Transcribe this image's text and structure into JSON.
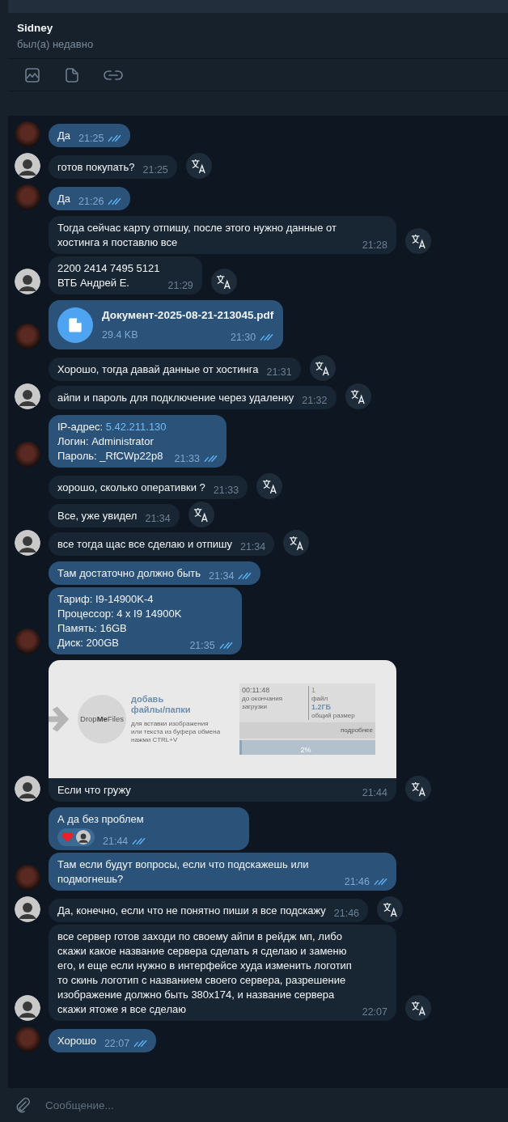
{
  "chat": {
    "name": "Sidney",
    "status": "был(а) недавно"
  },
  "toolbar": [
    {
      "kind": "media"
    },
    {
      "kind": "file"
    },
    {
      "kind": "link"
    }
  ],
  "messages": [
    {
      "kind": "text",
      "outgoing": true,
      "avatar": true,
      "text": "Да",
      "time": "21:25",
      "read": true
    },
    {
      "kind": "text",
      "outgoing": false,
      "avatar": true,
      "text": "готов покупать?",
      "time": "21:25"
    },
    {
      "kind": "text",
      "outgoing": true,
      "avatar": true,
      "text": "Да",
      "time": "21:26",
      "read": true
    },
    {
      "kind": "text",
      "outgoing": false,
      "avatar": false,
      "text": "Тогда сейчас карту отпишу, после этого нужно данные от хостинга я поставлю все",
      "time": "21:28"
    },
    {
      "kind": "text",
      "outgoing": false,
      "avatar": true,
      "text": "2200 2414 7495 5121\nВТБ Андрей Е.",
      "time": "21:29"
    },
    {
      "kind": "file",
      "outgoing": true,
      "avatar": true,
      "file_name": "Документ-2025-08-21-213045.pdf",
      "size": "29.4 KB",
      "time": "21:30",
      "read": true
    },
    {
      "kind": "text",
      "outgoing": false,
      "avatar": false,
      "text": "Хорошо, тогда давай данные от хостинга",
      "time": "21:31"
    },
    {
      "kind": "text",
      "outgoing": false,
      "avatar": true,
      "text": "айпи и пароль для подключение через удаленку",
      "time": "21:32"
    },
    {
      "kind": "credentials",
      "outgoing": true,
      "avatar": true,
      "label": "IP-адрес: ",
      "link": "5.42.211.130",
      "text": "Логин: Administrator\nПароль: _RfCWp22p8",
      "time": "21:33",
      "read": true
    },
    {
      "kind": "text",
      "outgoing": false,
      "avatar": false,
      "text": "хорошо, сколько оперативки ?",
      "time": "21:33"
    },
    {
      "kind": "text",
      "outgoing": false,
      "avatar": false,
      "text": "Все, уже увидел",
      "time": "21:34"
    },
    {
      "kind": "text",
      "outgoing": false,
      "avatar": true,
      "text": "все тогда щас все сделаю и отпишу",
      "time": "21:34"
    },
    {
      "kind": "text",
      "outgoing": true,
      "avatar": false,
      "text": "Там достаточно должно быть",
      "time": "21:34",
      "read": true
    },
    {
      "kind": "text",
      "outgoing": true,
      "avatar": true,
      "text": "Тариф: I9-14900K-4\nПроцессор: 4 x I9 14900K\nПамять: 16GB\nДиск: 200GB",
      "time": "21:35",
      "read": true
    },
    {
      "kind": "image",
      "outgoing": false,
      "avatar": true,
      "text": "Если что гружу",
      "time": "21:44",
      "image": {
        "logo_left": "Drop",
        "logo_mid": "Me",
        "logo_right": "Files",
        "title": "добавь\nфайлы/папки",
        "hint": "для вставки изображения\nили текста из буфера обмена\nнажми CTRL+V",
        "timer": "00:11:48",
        "timer_label": "до окончания\nзагрузки",
        "count": "1",
        "count_label": "файл",
        "total": "1.2ГБ",
        "total_label": "общий размер",
        "more": "подробнее",
        "progress": "2%",
        "level": 0.02
      }
    },
    {
      "kind": "text",
      "outgoing": true,
      "avatar": false,
      "text": "А да без проблем",
      "time": "21:44",
      "read": true,
      "reaction": true
    },
    {
      "kind": "text",
      "outgoing": true,
      "avatar": true,
      "text": "Там если будут вопросы, если что подскажешь или подмогнешь?",
      "time": "21:46",
      "read": true
    },
    {
      "kind": "text",
      "outgoing": false,
      "avatar": true,
      "text": "Да, конечно, если что не понятно пиши я все подскажу",
      "time": "21:46"
    },
    {
      "kind": "text",
      "outgoing": false,
      "avatar": true,
      "text": "все сервер готов заходи по своему айпи в рейдж мп, либо скажи какое название сервера сделать я сделаю и заменю его, и еще если нужно в интерфейсе худа изменить логотип то скинь логотип с названием своего сервера, разрешение изображение должно быть 380x174, и название сервера скажи ятоже я все сделаю",
      "time": "22:07"
    },
    {
      "kind": "text",
      "outgoing": true,
      "avatar": true,
      "text": "Хорошо",
      "time": "22:07",
      "read": true
    }
  ],
  "composer": {
    "placeholder": "Сообщение..."
  }
}
